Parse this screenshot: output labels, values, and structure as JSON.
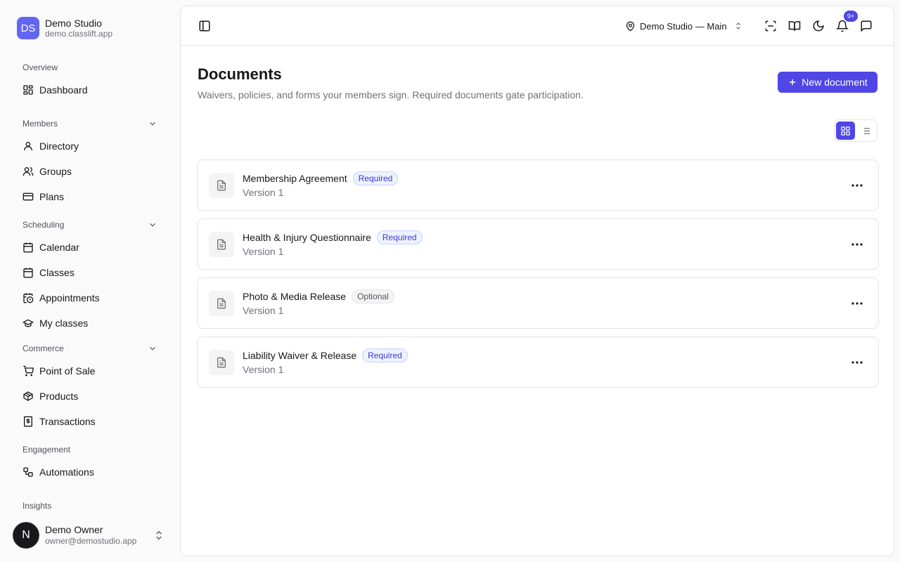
{
  "org": {
    "initials": "DS",
    "name": "Demo Studio",
    "domain": "demo.classlift.app"
  },
  "sidebar": {
    "sections": [
      {
        "title": "Overview",
        "collapsible": false,
        "items": [
          {
            "label": "Dashboard",
            "icon": "dashboard-icon"
          }
        ]
      },
      {
        "title": "Members",
        "collapsible": true,
        "items": [
          {
            "label": "Directory",
            "icon": "user-icon"
          },
          {
            "label": "Groups",
            "icon": "users-icon"
          },
          {
            "label": "Plans",
            "icon": "credit-card-icon"
          }
        ]
      },
      {
        "title": "Scheduling",
        "collapsible": true,
        "items": [
          {
            "label": "Calendar",
            "icon": "calendar-icon"
          },
          {
            "label": "Classes",
            "icon": "calendar-icon"
          },
          {
            "label": "Appointments",
            "icon": "calendar-clock-icon"
          },
          {
            "label": "My classes",
            "icon": "graduation-cap-icon"
          }
        ]
      },
      {
        "title": "Commerce",
        "collapsible": true,
        "items": [
          {
            "label": "Point of Sale",
            "icon": "cart-icon"
          },
          {
            "label": "Products",
            "icon": "package-icon"
          },
          {
            "label": "Transactions",
            "icon": "receipt-dollar-icon"
          }
        ]
      },
      {
        "title": "Engagement",
        "collapsible": false,
        "items": [
          {
            "label": "Automations",
            "icon": "workflow-icon"
          }
        ]
      },
      {
        "title": "Insights",
        "collapsible": false,
        "items": []
      }
    ]
  },
  "user": {
    "initial": "N",
    "name": "Demo Owner",
    "email": "owner@demostudio.app"
  },
  "topbar": {
    "location": "Demo Studio — Main",
    "notification_count": "9+"
  },
  "page": {
    "title": "Documents",
    "subtitle": "Waivers, policies, and forms your members sign. Required documents gate participation.",
    "new_button": "New document"
  },
  "documents": [
    {
      "title": "Membership Agreement",
      "status": "Required",
      "version": "Version 1"
    },
    {
      "title": "Health & Injury Questionnaire",
      "status": "Required",
      "version": "Version 1"
    },
    {
      "title": "Photo & Media Release",
      "status": "Optional",
      "version": "Version 1"
    },
    {
      "title": "Liability Waiver & Release",
      "status": "Required",
      "version": "Version 1"
    }
  ],
  "colors": {
    "accent": "#4f46e5",
    "org_logo": "#6366f1"
  }
}
